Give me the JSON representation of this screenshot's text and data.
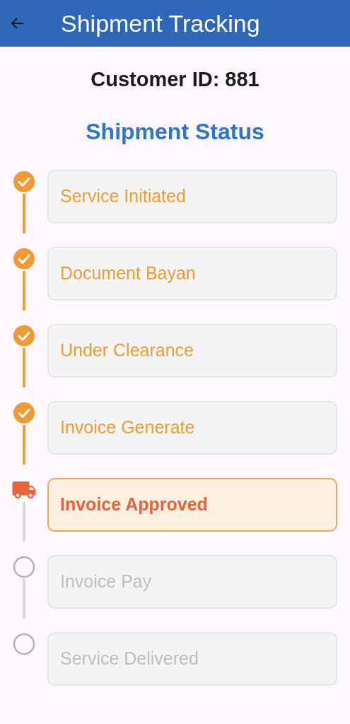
{
  "app_bar": {
    "title": "Shipment Tracking"
  },
  "customer_id": "Customer ID: 881",
  "section_title": "Shipment Status",
  "steps": [
    {
      "label": "Service Initiated",
      "kind": "done"
    },
    {
      "label": "Document Bayan",
      "kind": "done"
    },
    {
      "label": "Under Clearance",
      "kind": "done"
    },
    {
      "label": "Invoice Generate",
      "kind": "done"
    },
    {
      "label": "Invoice Approved",
      "kind": "current"
    },
    {
      "label": "Invoice Pay",
      "kind": "pending"
    },
    {
      "label": "Service Delivered",
      "kind": "pending"
    }
  ]
}
